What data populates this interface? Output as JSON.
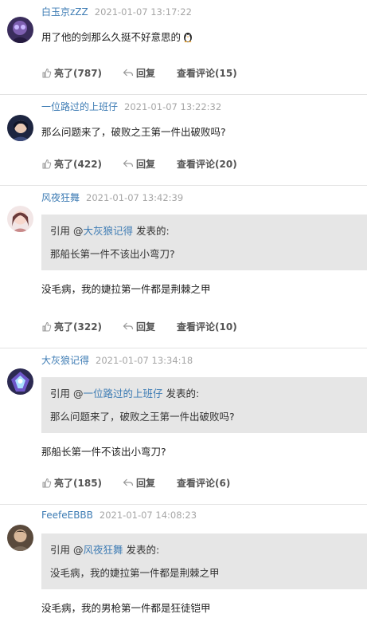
{
  "labels": {
    "like": "亮了",
    "reply": "回复",
    "view_comments": "查看评论",
    "quote_prefix": "引用 @",
    "quote_suffix": " 发表的:"
  },
  "comments": [
    {
      "username": "白玉京zZZ",
      "timestamp": "2021-01-07 13:17:22",
      "text": "用了他的剑那么久挺不好意思的",
      "emoji": "qq-penguin-icon",
      "likes": "(787)",
      "replies": "(15)"
    },
    {
      "username": "一位路过的上班仔",
      "timestamp": "2021-01-07 13:22:32",
      "text": "那么问题来了，破败之王第一件出破败吗?",
      "likes": "(422)",
      "replies": "(20)"
    },
    {
      "username": "风夜狂舞",
      "timestamp": "2021-01-07 13:42:39",
      "quote": {
        "user": "大灰狼记得",
        "text": "那船长第一件不该出小弯刀?"
      },
      "text": "没毛病，我的婕拉第一件都是荆棘之甲",
      "likes": "(322)",
      "replies": "(10)"
    },
    {
      "username": "大灰狼记得",
      "timestamp": "2021-01-07 13:34:18",
      "quote": {
        "user": "一位路过的上班仔",
        "text": "那么问题来了，破败之王第一件出破败吗?"
      },
      "text": "那船长第一件不该出小弯刀?",
      "likes": "(185)",
      "replies": "(6)"
    },
    {
      "username": "FeefeEBBB",
      "timestamp": "2021-01-07 14:08:23",
      "quote": {
        "user": "风夜狂舞",
        "text": "没毛病，我的婕拉第一件都是荆棘之甲"
      },
      "text": "没毛病，我的男枪第一件都是狂徒铠甲"
    }
  ],
  "colors": {
    "username": "#3e7cb4",
    "timestamp": "#a6a6a6",
    "quote_bg": "#e6e6e6",
    "divider": "#e9ebee"
  }
}
